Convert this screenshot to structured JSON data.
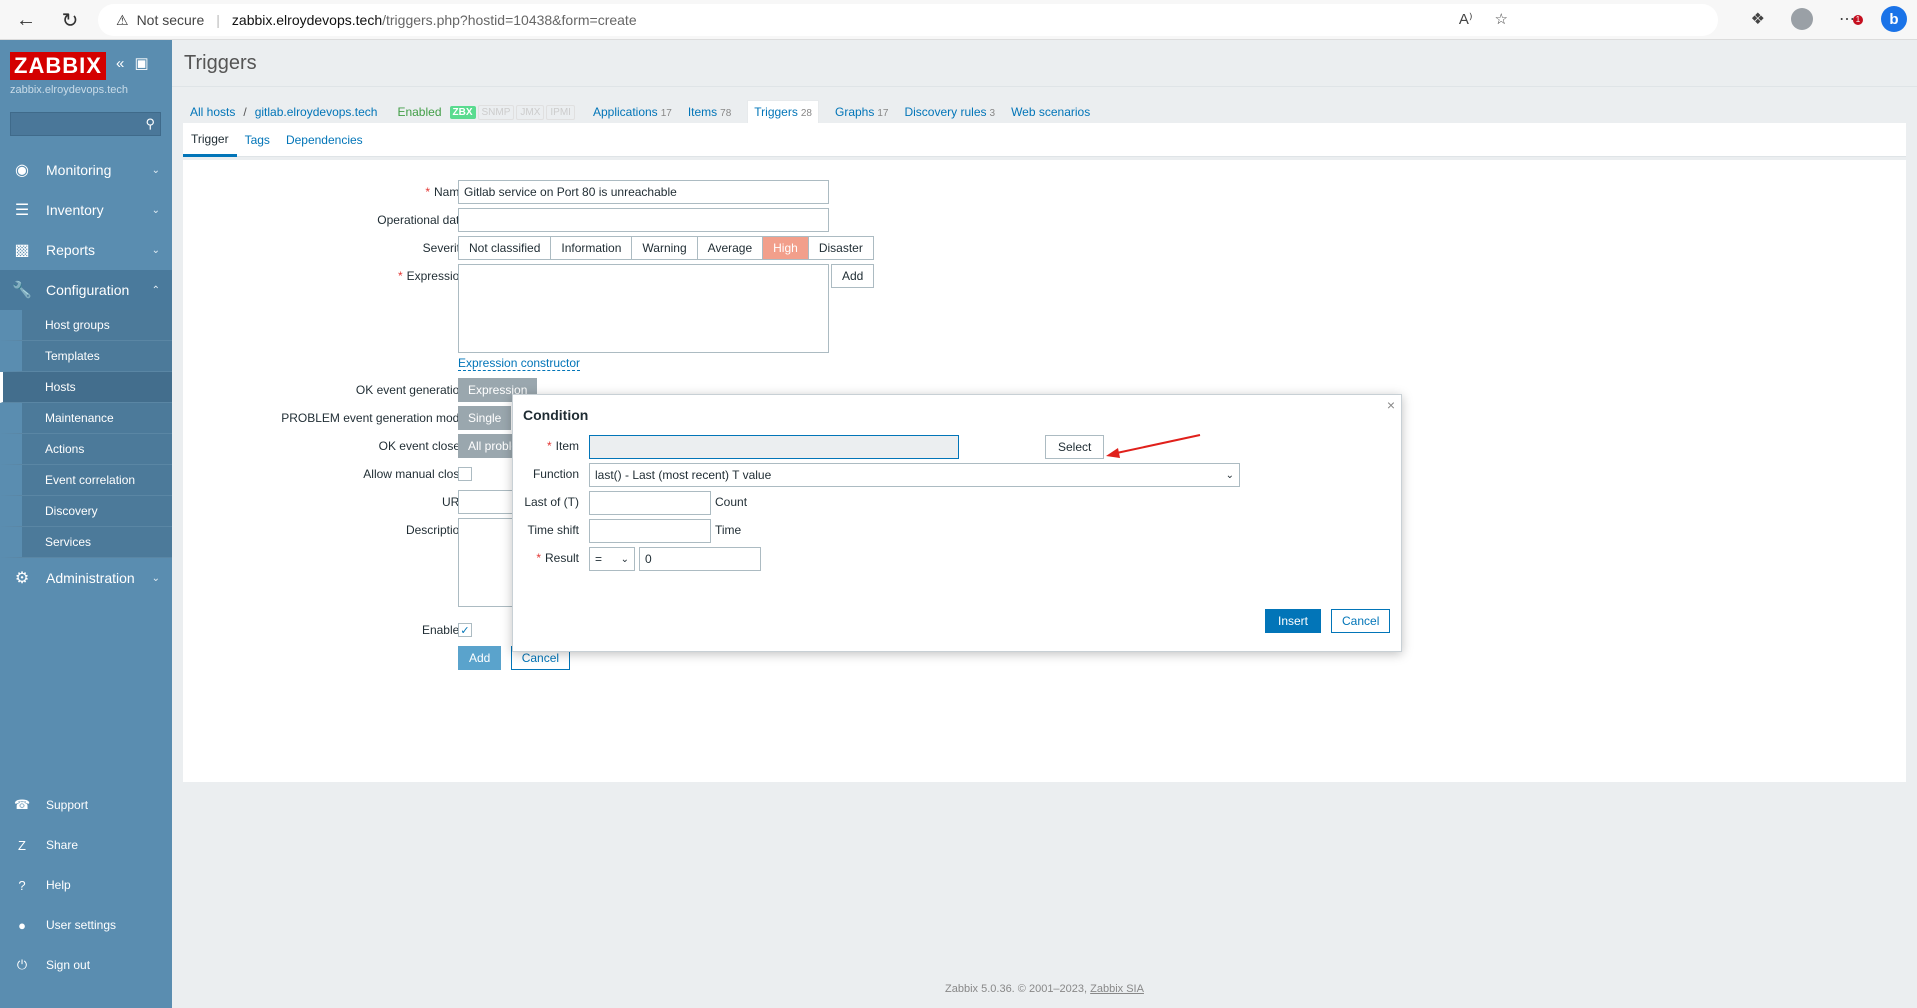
{
  "browser": {
    "not_secure": "Not secure",
    "url_host": "zabbix.elroydevops.tech",
    "url_path": "/triggers.php?hostid=10438&form=create"
  },
  "sidebar": {
    "logo": "ZABBIX",
    "server": "zabbix.elroydevops.tech",
    "menu": [
      {
        "label": "Monitoring"
      },
      {
        "label": "Inventory"
      },
      {
        "label": "Reports"
      },
      {
        "label": "Configuration"
      },
      {
        "label": "Administration"
      }
    ],
    "submenu": [
      "Host groups",
      "Templates",
      "Hosts",
      "Maintenance",
      "Actions",
      "Event correlation",
      "Discovery",
      "Services"
    ],
    "bottom": [
      "Support",
      "Share",
      "Help",
      "User settings",
      "Sign out"
    ]
  },
  "page": {
    "title": "Triggers",
    "breadcrumbs": {
      "all_hosts": "All hosts",
      "host": "gitlab.elroydevops.tech",
      "status": "Enabled",
      "avail": [
        "ZBX",
        "SNMP",
        "JMX",
        "IPMI"
      ],
      "nav": [
        {
          "label": "Applications",
          "count": "17"
        },
        {
          "label": "Items",
          "count": "78"
        },
        {
          "label": "Triggers",
          "count": "28"
        },
        {
          "label": "Graphs",
          "count": "17"
        },
        {
          "label": "Discovery rules",
          "count": "3"
        },
        {
          "label": "Web scenarios",
          "count": ""
        }
      ]
    },
    "tabs": [
      "Trigger",
      "Tags",
      "Dependencies"
    ]
  },
  "form": {
    "name_label": "Name",
    "name_value": "Gitlab service on Port 80 is unreachable",
    "opdata_label": "Operational data",
    "severity_label": "Severity",
    "severities": [
      "Not classified",
      "Information",
      "Warning",
      "Average",
      "High",
      "Disaster"
    ],
    "severity_selected": "High",
    "expression_label": "Expression",
    "add_label": "Add",
    "expr_constructor": "Expression constructor",
    "ok_event_label": "OK event generation",
    "ok_event_value": "Expression",
    "problem_mode_label": "PROBLEM event generation mode",
    "problem_mode_value": "Single",
    "ok_closes_label": "OK event closes",
    "ok_closes_value": "All problems",
    "manual_close_label": "Allow manual close",
    "url_label": "URL",
    "description_label": "Description",
    "enabled_label": "Enabled",
    "submit_label": "Add",
    "cancel_label": "Cancel"
  },
  "dialog": {
    "title": "Condition",
    "item_label": "Item",
    "select_label": "Select",
    "function_label": "Function",
    "function_value": "last() - Last (most recent) T value",
    "last_of_label": "Last of (T)",
    "last_of_unit": "Count",
    "time_shift_label": "Time shift",
    "time_shift_unit": "Time",
    "result_label": "Result",
    "result_op": "=",
    "result_value": "0",
    "insert_label": "Insert",
    "cancel_label": "Cancel"
  },
  "footer": {
    "text": "Zabbix 5.0.36. © 2001–2023, ",
    "company": "Zabbix SIA"
  },
  "colors": {
    "sidebar": "#5a8db0",
    "primary": "#0275b8",
    "severity_high": "#f29f8b",
    "logo": "#d40000"
  }
}
